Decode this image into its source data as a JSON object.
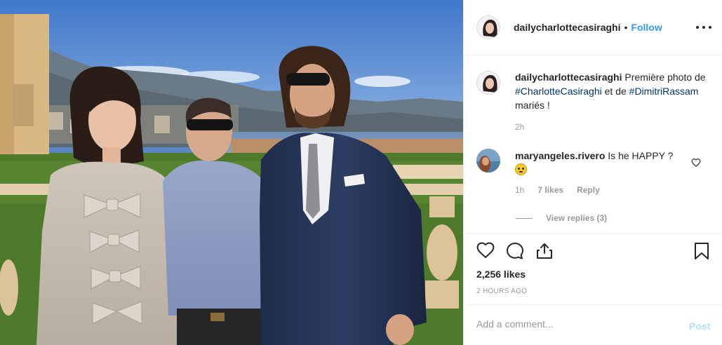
{
  "post": {
    "username": "dailycharlottecasiraghi",
    "separator": "•",
    "follow_label": "Follow",
    "more_icon": "more-horizontal-icon"
  },
  "caption": {
    "username": "dailycharlottecasiraghi",
    "text_before": " Première photo de ",
    "tag1": "#CharlotteCasiraghi",
    "text_middle": " et de ",
    "tag2": "#DimitriRassam",
    "text_after": " mariés !",
    "time": "2h"
  },
  "comment": {
    "username": "maryangeles.rivero",
    "text": " Is he HAPPY ? ",
    "emoji": "flushed-face-emoji",
    "time": "1h",
    "likes": "7 likes",
    "reply_label": "Reply",
    "view_replies": "View replies (3)"
  },
  "actions": {
    "likes": "2,256 likes",
    "ago": "2 HOURS AGO",
    "comment_placeholder": "Add a comment...",
    "post_label": "Post"
  },
  "colors": {
    "link": "#3897f0",
    "hashtag": "#003569",
    "muted": "#999999",
    "post_disabled": "#b2dffc"
  }
}
